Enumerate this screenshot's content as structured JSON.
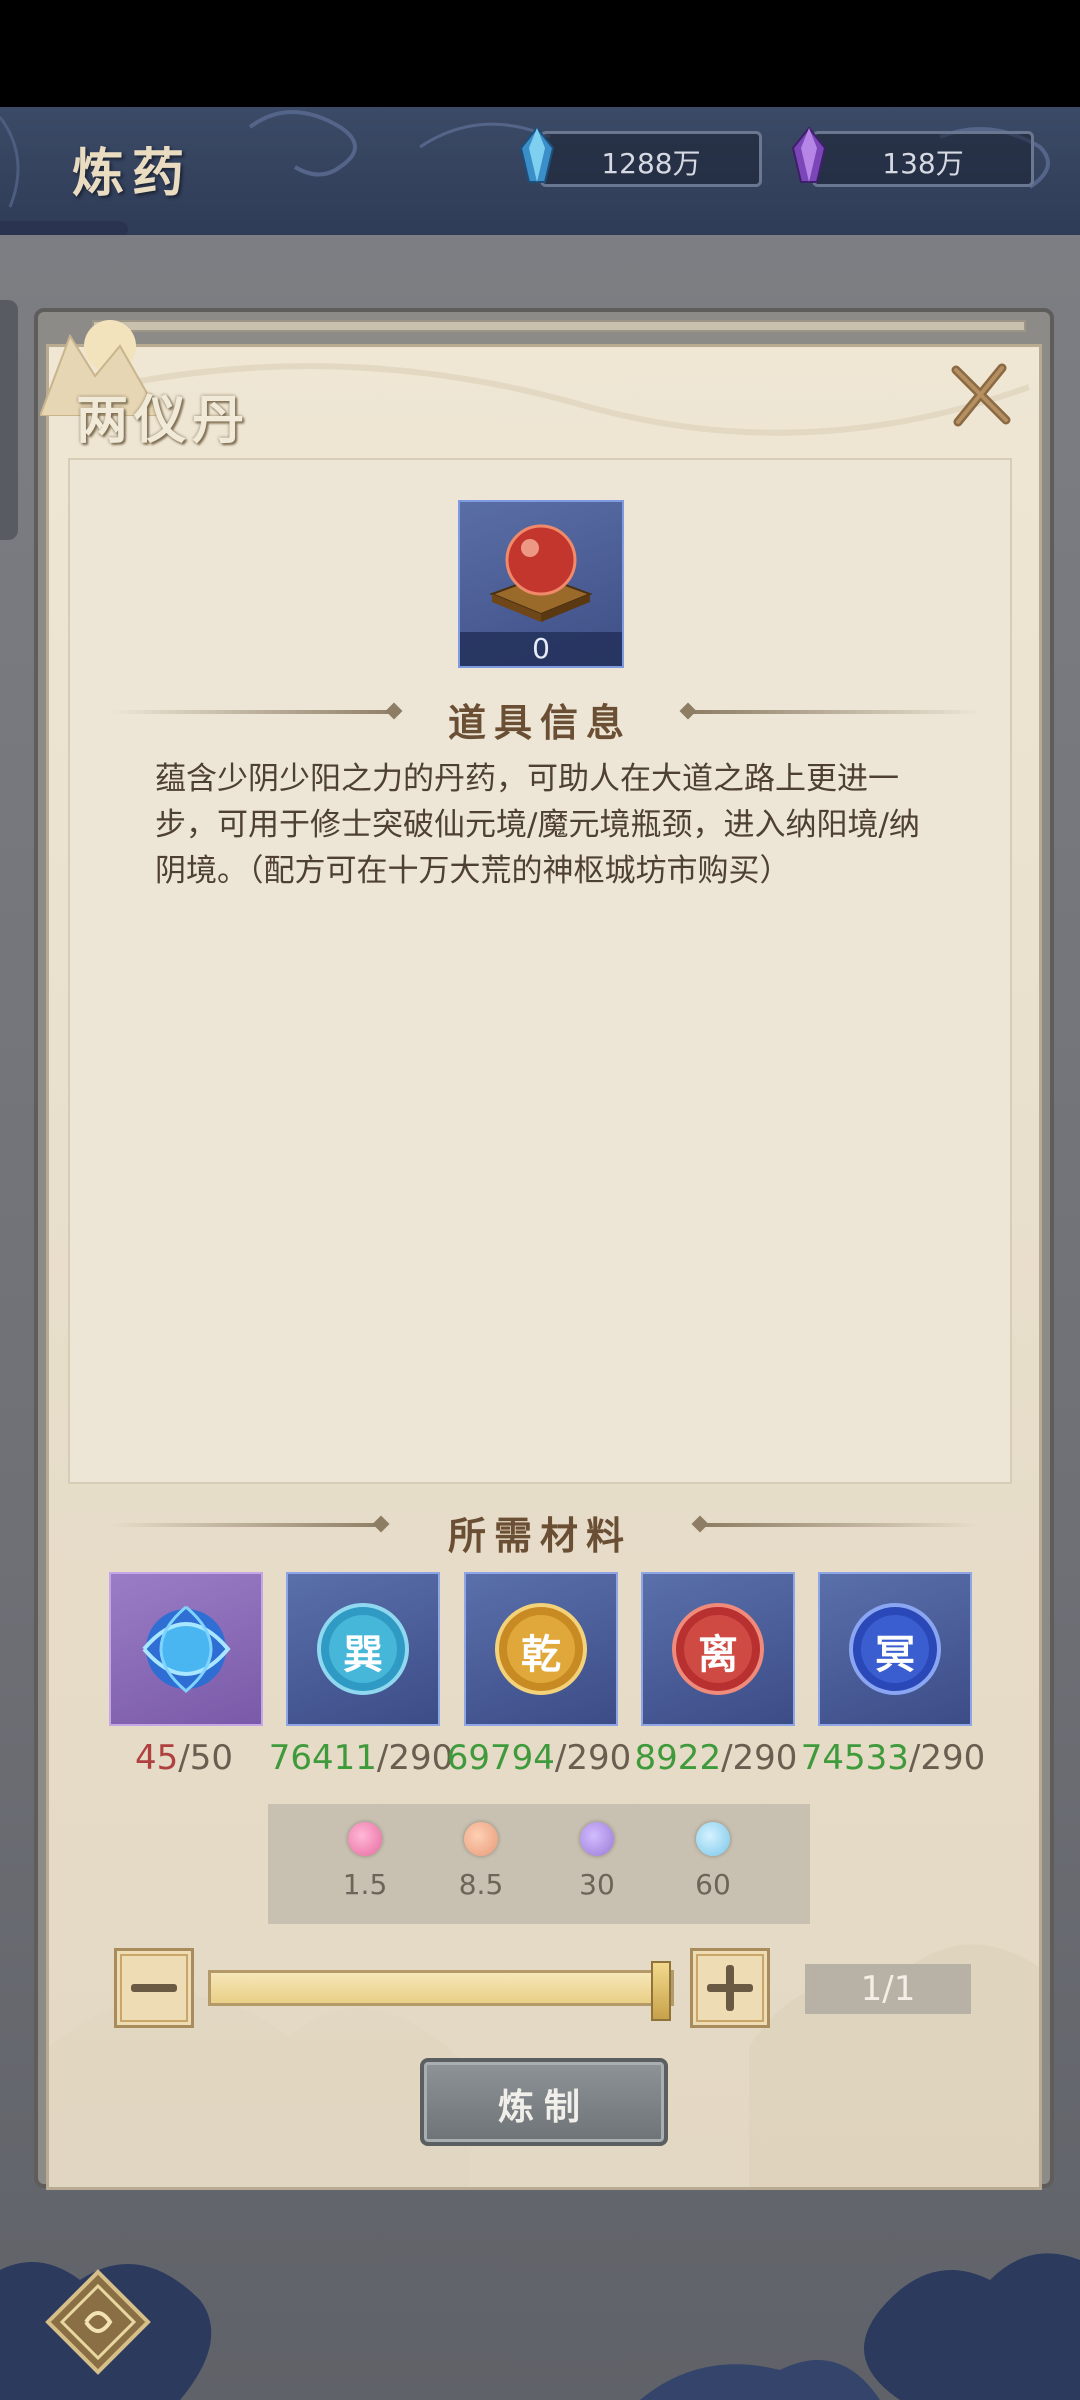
{
  "header": {
    "title": "炼药",
    "currency_1": {
      "icon": "blue-crystal-icon",
      "value": "1288万"
    },
    "currency_2": {
      "icon": "purple-crystal-icon",
      "value": "138万"
    }
  },
  "item": {
    "name": "两仪丹",
    "owned_count": "0",
    "icon": "red-pill-icon"
  },
  "info": {
    "section_title": "道具信息",
    "description": "蕴含少阴少阳之力的丹药，可助人在大道之路上更进一步，可用于修士突破仙元境/魔元境瓶颈，进入纳阳境/纳阴境。（配方可在十万大荒的神枢城坊市购买）"
  },
  "materials": {
    "section_title": "所需材料",
    "items": [
      {
        "icon": "blue-energy-orb-icon",
        "glyph": "",
        "have": "45",
        "need": "/50",
        "sufficient": false
      },
      {
        "icon": "xun-orb-icon",
        "glyph": "巽",
        "have": "76411",
        "need": "/290",
        "sufficient": true
      },
      {
        "icon": "qian-orb-icon",
        "glyph": "乾",
        "have": "69794",
        "need": "/290",
        "sufficient": true
      },
      {
        "icon": "li-orb-icon",
        "glyph": "离",
        "have": "8922",
        "need": "/290",
        "sufficient": true
      },
      {
        "icon": "ming-orb-icon",
        "glyph": "冥",
        "have": "74533",
        "need": "/290",
        "sufficient": true
      }
    ]
  },
  "pills": [
    {
      "color": "#e86aa0",
      "label": "1.5"
    },
    {
      "color": "#e69a78",
      "label": "8.5"
    },
    {
      "color": "#9a7ad6",
      "label": "30"
    },
    {
      "color": "#7ac6ea",
      "label": "60"
    }
  ],
  "quantity": {
    "display": "1/1",
    "current": 1,
    "max": 1,
    "minus_icon": "minus-icon",
    "plus_icon": "plus-icon"
  },
  "craft_button": {
    "label": "炼制"
  },
  "colors": {
    "header_bg": "#2f3c57",
    "panel_bg": "#ede6d6",
    "ok_green": "#3f9a3b",
    "low_red": "#b04040"
  }
}
